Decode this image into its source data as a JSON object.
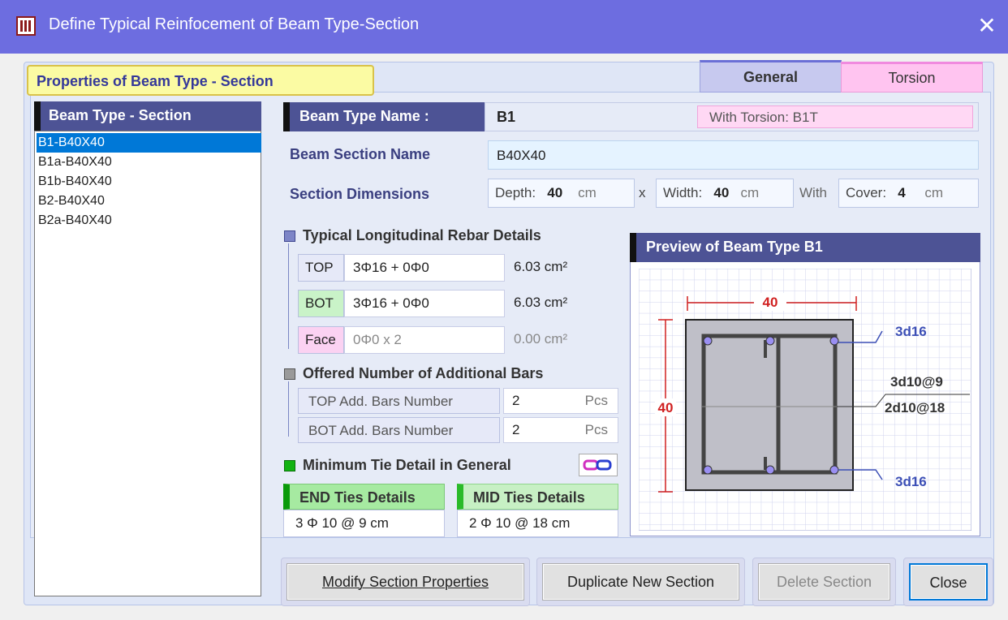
{
  "window": {
    "title": "Define Typical Reinfocement of Beam Type-Section",
    "close_glyph": "✕"
  },
  "tabs": {
    "properties": "Properties of Beam Type - Section",
    "general": "General",
    "torsion": "Torsion"
  },
  "list": {
    "header": "Beam Type - Section",
    "items": [
      "B1-B40X40",
      "B1a-B40X40",
      "B1b-B40X40",
      "B2-B40X40",
      "B2a-B40X40"
    ],
    "selected": "B1-B40X40"
  },
  "beam": {
    "name_label": "Beam Type Name :",
    "name": "B1",
    "torsion": "With Torsion: B1T",
    "section_name_label": "Beam Section Name",
    "section_name": "B40X40",
    "dimensions_label": "Section Dimensions",
    "depth_label": "Depth:",
    "depth": "40",
    "depth_unit": "cm",
    "times": "x",
    "width_label": "Width:",
    "width": "40",
    "width_unit": "cm",
    "with": "With",
    "cover_label": "Cover:",
    "cover": "4",
    "cover_unit": "cm"
  },
  "longitudinal": {
    "title": "Typical Longitudinal Rebar Details",
    "top_tag": "TOP",
    "top_value": "3Φ16 + 0Φ0",
    "top_area": "6.03 cm²",
    "bot_tag": "BOT",
    "bot_value": "3Φ16 + 0Φ0",
    "bot_area": "6.03 cm²",
    "face_tag": "Face",
    "face_value": "0Φ0   x 2",
    "face_area": "0.00 cm²"
  },
  "additional": {
    "title": "Offered Number of Additional Bars",
    "top_label": "TOP Add. Bars Number",
    "top_value": "2",
    "top_unit": "Pcs",
    "bot_label": "BOT Add. Bars Number",
    "bot_value": "2",
    "bot_unit": "Pcs"
  },
  "ties": {
    "title": "Minimum Tie Detail in General",
    "end_label": "END Ties Details",
    "end_value": "3  Φ  10 @  9  cm",
    "mid_label": "MID Ties Details",
    "mid_value": "2  Φ  10 @ 18 cm"
  },
  "preview": {
    "title": "Preview of Beam Type B1",
    "width_dim": "40",
    "depth_dim": "40",
    "top_bars": "3d16",
    "bot_bars": "3d16",
    "tie_end": "3d10@9",
    "tie_mid": "2d10@18"
  },
  "buttons": {
    "modify": "Modify Section Properties",
    "duplicate": "Duplicate New Section",
    "delete": "Delete Section",
    "close": "Close"
  },
  "colors": {
    "titlebar": "#6d6de0",
    "header_dark": "#4d5395",
    "selection": "#0078d7",
    "dim_red": "#d02020",
    "bar_label_blue": "#3c4fb6"
  }
}
